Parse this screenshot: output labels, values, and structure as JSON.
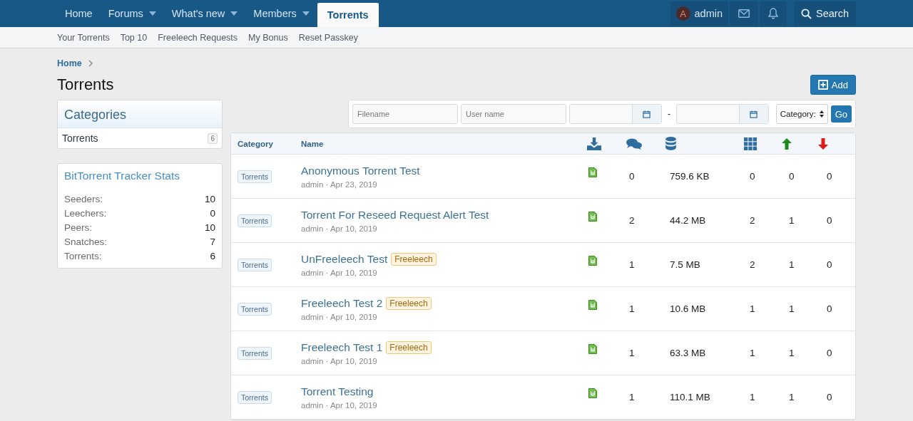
{
  "nav": {
    "tabs": [
      {
        "label": "Home",
        "selected": false,
        "menu": false
      },
      {
        "label": "Forums",
        "selected": false,
        "menu": true
      },
      {
        "label": "What's new",
        "selected": false,
        "menu": true
      },
      {
        "label": "Members",
        "selected": false,
        "menu": true
      },
      {
        "label": "Torrents",
        "selected": true,
        "menu": false
      }
    ],
    "user": {
      "avatar_letter": "A",
      "name": "admin"
    },
    "search": "Search"
  },
  "subnav": [
    "Your Torrents",
    "Top 10",
    "Freeleech Requests",
    "My Bonus",
    "Reset Passkey"
  ],
  "breadcrumb": [
    "Home"
  ],
  "page_title": "Torrents",
  "add_button": "Add",
  "categories": {
    "title": "Categories",
    "items": [
      {
        "label": "Torrents",
        "count": "6"
      }
    ]
  },
  "stats": {
    "title": "BitTorrent Tracker Stats",
    "rows": [
      {
        "label": "Seeders:",
        "value": "10"
      },
      {
        "label": "Leechers:",
        "value": "0"
      },
      {
        "label": "Peers:",
        "value": "10"
      },
      {
        "label": "Snatches:",
        "value": "7"
      },
      {
        "label": "Torrents:",
        "value": "6"
      }
    ]
  },
  "filter": {
    "filename_placeholder": "Filename",
    "username_placeholder": "User name",
    "date_separator": "-",
    "category_select": "Category:",
    "go": "Go"
  },
  "table": {
    "columns": [
      "Category",
      "Name"
    ],
    "rows": [
      {
        "category": "Torrents",
        "name": "Anonymous Torrent Test",
        "badge": null,
        "meta": "admin · Apr 23, 2019",
        "comments": "0",
        "size": "759.6 KB",
        "files": "0",
        "seeders": "0",
        "leechers": "0"
      },
      {
        "category": "Torrents",
        "name": "Torrent For Reseed Request Alert Test",
        "badge": null,
        "meta": "admin · Apr 10, 2019",
        "comments": "2",
        "size": "44.2 MB",
        "files": "2",
        "seeders": "1",
        "leechers": "0"
      },
      {
        "category": "Torrents",
        "name": "UnFreeleech Test",
        "badge": "Freeleech",
        "meta": "admin · Apr 10, 2019",
        "comments": "1",
        "size": "7.5 MB",
        "files": "2",
        "seeders": "1",
        "leechers": "0"
      },
      {
        "category": "Torrents",
        "name": "Freeleech Test 2",
        "badge": "Freeleech",
        "meta": "admin · Apr 10, 2019",
        "comments": "1",
        "size": "10.6 MB",
        "files": "1",
        "seeders": "1",
        "leechers": "0"
      },
      {
        "category": "Torrents",
        "name": "Freeleech Test 1",
        "badge": "Freeleech",
        "meta": "admin · Apr 10, 2019",
        "comments": "1",
        "size": "63.3 MB",
        "files": "1",
        "seeders": "1",
        "leechers": "0"
      },
      {
        "category": "Torrents",
        "name": "Torrent Testing",
        "badge": null,
        "meta": "admin · Apr 10, 2019",
        "comments": "1",
        "size": "110.1 MB",
        "files": "1",
        "seeders": "1",
        "leechers": "0"
      }
    ]
  }
}
